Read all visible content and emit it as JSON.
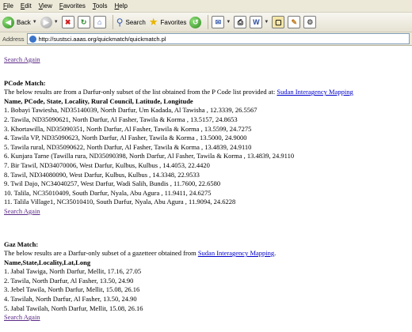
{
  "menu": [
    "File",
    "Edit",
    "View",
    "Favorites",
    "Tools",
    "Help"
  ],
  "toolbar": {
    "back": "Back",
    "search": "Search",
    "favorites": "Favorites"
  },
  "address": {
    "label": "Address",
    "url": "http://sustsci.aaas.org/quickmatch/quickmatch.pl"
  },
  "links": {
    "search_again": "Search Again",
    "sudan_mapping": "Sudan Interagency Mapping"
  },
  "pcode": {
    "heading": "PCode Match:",
    "intro": "The below results are from a Darfur-only subset of the list obtained from the P Code list provided at: ",
    "intro_end": "",
    "columns": "Name, PCode, State, Locality, Rural Council, Latitude, Longitude",
    "rows": [
      "1. Bobayi Tawiesha, ND35140039, North Darfur, Um Kadada, Al Tawisha , 12.3339, 26.5567",
      "2. Tawila, ND35090621, North Darfur, Al Fasher, Tawila & Korma , 13.5157, 24.8653",
      "3. Khortawilla, ND35090351, North Darfur, Al Fasher, Tawila & Korma , 13.5599, 24.7275",
      "4. Tawila VP, ND35090623, North Darfur, Al Fasher, Tawila & Korma , 13.5000, 24.9000",
      "5. Tawila rural, ND35090622, North Darfur, Al Fasher, Tawila & Korma , 13.4839, 24.9110",
      "6. Kunjara Tarne (Tawilla rura, ND35090398, North Darfur, Al Fasher, Tawila & Korma , 13.4839, 24.9110",
      "7. Bir Tawil, ND34070006, West Darfur, Kulbus, Kulbus , 14.4053, 22.4420",
      "8. Tawil, ND34080090, West Darfur, Kulbus, Kulbus , 14.3348, 22.9533",
      "9. Twil Dajo, NC34040257, West Darfur, Wadi Salih, Bundis , 11.7600, 22.6580",
      "10. Talila, NC35010409, South Darfur, Nyala, Abu Agura , 11.9411, 24.6275",
      "11. Talila Village1, NC35010410, South Darfur, Nyala, Abu Agura , 11.9094, 24.6228"
    ]
  },
  "gaz": {
    "heading": "Gaz Match:",
    "intro": "The below results are a Darfur-only subset of a gazetteer obtained from ",
    "intro_end": ".",
    "columns": "Name,State,Locality,Lat,Long",
    "rows": [
      "1. Jabal Tawiga, North Darfur, Mellit, 17.16, 27.05",
      "2. Tawila, North Darfur, Al Fasher, 13.50, 24.90",
      "3. Jebel Tawila, North Darfur, Mellit, 15.08, 26.16",
      "4. Tawilah, North Darfur, Al Fasher, 13.50, 24.90",
      "5. Jabal Tawilah, North Darfur, Mellit, 15.08, 26.16"
    ]
  }
}
